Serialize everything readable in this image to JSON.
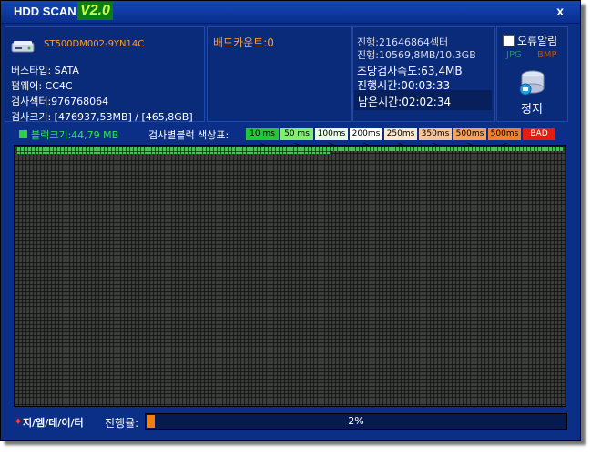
{
  "title": {
    "app_name": "HDD SCAN",
    "version": "V2.0",
    "close": "x"
  },
  "drive": {
    "model": "ST500DM002-9YN14C",
    "bus_type": "버스타입: SATA",
    "firmware": "펌웨어: CC4C",
    "sectors": "검사섹터:976768064",
    "size": "검사크기: [476937,53MB] / [465,8GB]"
  },
  "bad_count": "배드카운트:0",
  "stats": {
    "progress": "진행:21646864섹터",
    "progress_mb": "진행:10569,8MB/10,3GB",
    "speed": "초당검사속도:63,4MB",
    "elapsed": "진행시간:00:03:33",
    "remaining": "남은시간:02:02:34"
  },
  "options": {
    "error_alarm": "오류알림",
    "jpg": "JPG",
    "bmp": "BMP",
    "stop": "정지"
  },
  "block_size": "블럭크기:44,79 MB",
  "legend_title": "검사별블럭 색상표:",
  "legend": [
    {
      "label": "10 ms >",
      "color": "#22c832"
    },
    {
      "label": "50 ms >",
      "color": "#7ef06e"
    },
    {
      "label": "100ms >",
      "color": "#e8fbe8"
    },
    {
      "label": "200ms >",
      "color": "#ffffff"
    },
    {
      "label": "250ms >",
      "color": "#fde7cf"
    },
    {
      "label": "350ms >",
      "color": "#f7c49a"
    },
    {
      "label": "500ms >",
      "color": "#f4a45c"
    },
    {
      "label": "500ms <",
      "color": "#f07e2a"
    },
    {
      "label": "BAD",
      "color": "#e81b10"
    }
  ],
  "grid": {
    "scanned_fraction": 0.02,
    "ok_color": "#2ed042"
  },
  "footer": {
    "brand": "지/엠/데/이/터",
    "progress_label": "진행율:",
    "progress_text": "2%",
    "progress_fraction": 0.02
  }
}
